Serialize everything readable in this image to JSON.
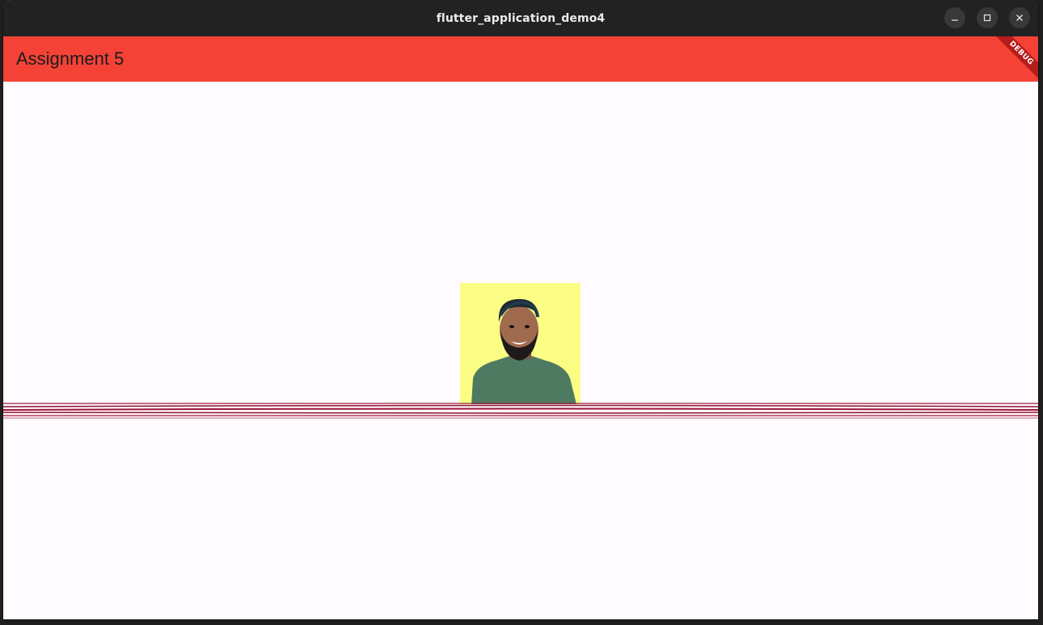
{
  "window": {
    "title": "flutter_application_demo4"
  },
  "window_controls": {
    "minimize_icon": "minimize-icon",
    "maximize_icon": "maximize-icon",
    "close_icon": "close-icon"
  },
  "appbar": {
    "title": "Assignment 5",
    "color": "#f44336"
  },
  "debug_banner": {
    "label": "DEBUG"
  },
  "content": {
    "photo_background": "#fbfd84",
    "divider_color": "#a0183c"
  }
}
